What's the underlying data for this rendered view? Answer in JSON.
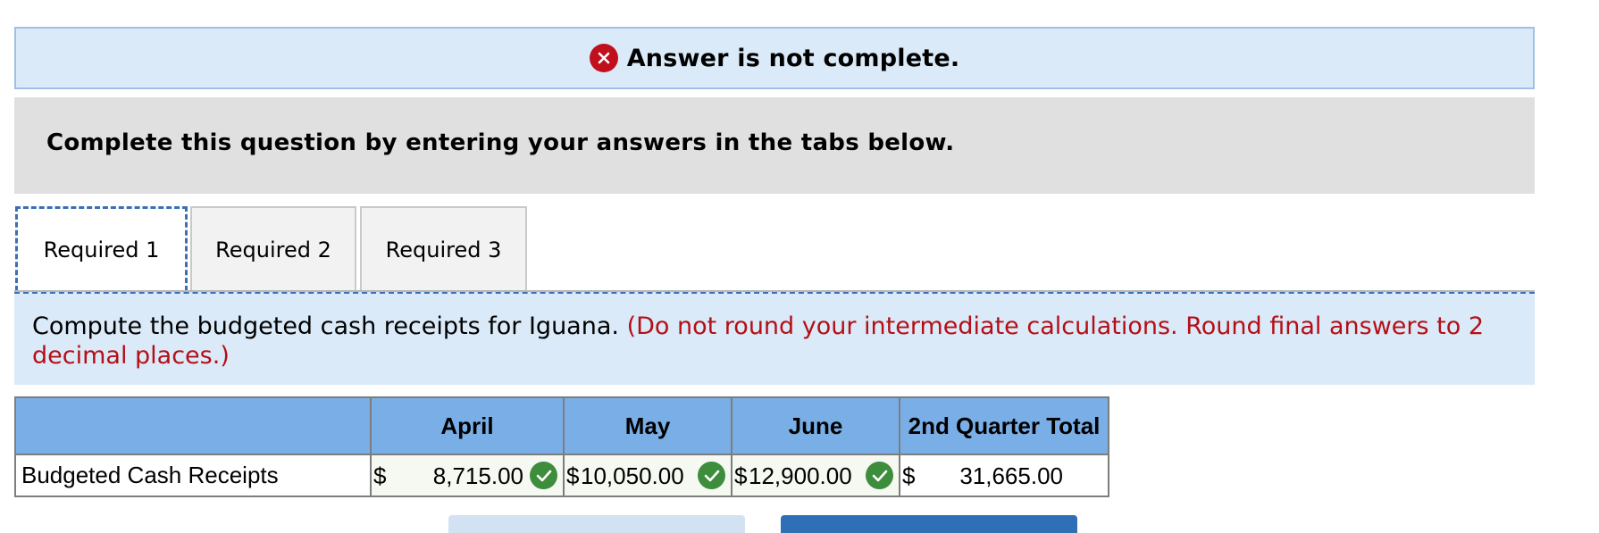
{
  "status": {
    "icon": "x-circle-icon",
    "title": "Answer is not complete."
  },
  "instructions": "Complete this question by entering your answers in the tabs below.",
  "tabs": [
    {
      "label": "Required 1",
      "active": true
    },
    {
      "label": "Required 2",
      "active": false
    },
    {
      "label": "Required 3",
      "active": false
    }
  ],
  "prompt": {
    "text": "Compute the budgeted cash receipts for Iguana.",
    "note": "(Do not round your intermediate calculations. Round final answers to 2 decimal places.)"
  },
  "table": {
    "headers": [
      "",
      "April",
      "May",
      "June",
      "2nd Quarter Total"
    ],
    "row": {
      "label": "Budgeted Cash Receipts",
      "cells": [
        {
          "currency": "$",
          "value": "8,715.00",
          "status": "correct"
        },
        {
          "currency": "$",
          "value": "10,050.00",
          "status": "correct"
        },
        {
          "currency": "$",
          "value": "12,900.00",
          "status": "correct"
        },
        {
          "currency": "$",
          "value": "31,665.00",
          "status": "none"
        }
      ]
    }
  },
  "colors": {
    "banner_bg": "#dbeaf8",
    "error_red": "#c0101e",
    "header_blue": "#7aaee6",
    "check_green": "#3e8d3c"
  }
}
